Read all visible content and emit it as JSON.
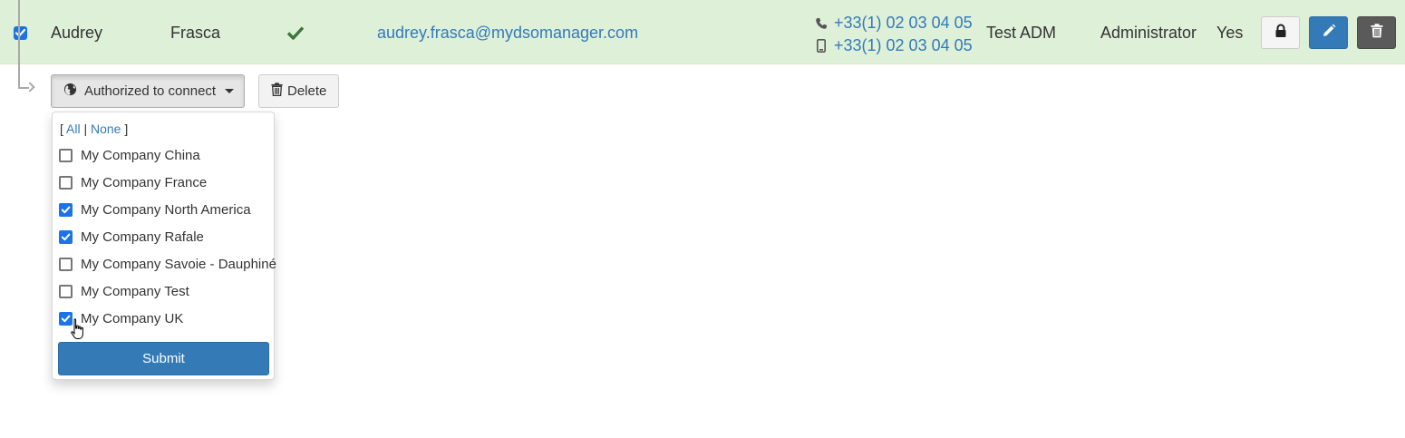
{
  "user_row": {
    "selected": true,
    "first_name": "Audrey",
    "last_name": "Frasca",
    "status_icon": "check-icon",
    "email": "audrey.frasca@mydsomanager.com",
    "phone": "+33(1) 02 03 04 05",
    "mobile": "+33(1) 02 03 04 05",
    "company": "Test ADM",
    "role": "Administrator",
    "active": "Yes",
    "buttons": {
      "lock": "lock-icon",
      "edit": "pencil-icon",
      "delete": "trash-icon"
    }
  },
  "actions": {
    "authorized_label": "Authorized to connect",
    "delete_label": "Delete"
  },
  "dropdown": {
    "bracket_open": "[",
    "all_label": "All",
    "separator": "|",
    "none_label": "None",
    "bracket_close": "]",
    "options": [
      {
        "label": "My Company China",
        "checked": false
      },
      {
        "label": "My Company France",
        "checked": false
      },
      {
        "label": "My Company North America",
        "checked": true
      },
      {
        "label": "My Company Rafale",
        "checked": true
      },
      {
        "label": "My Company Savoie - Dauphiné",
        "checked": false
      },
      {
        "label": "My Company Test",
        "checked": false
      },
      {
        "label": "My Company UK",
        "checked": true
      }
    ],
    "submit_label": "Submit"
  },
  "colors": {
    "row_success_bg": "#dff0d8",
    "link": "#337ab7",
    "primary": "#337ab7",
    "checkbox_checked": "#1a73e8",
    "status_green": "#3c763d"
  }
}
